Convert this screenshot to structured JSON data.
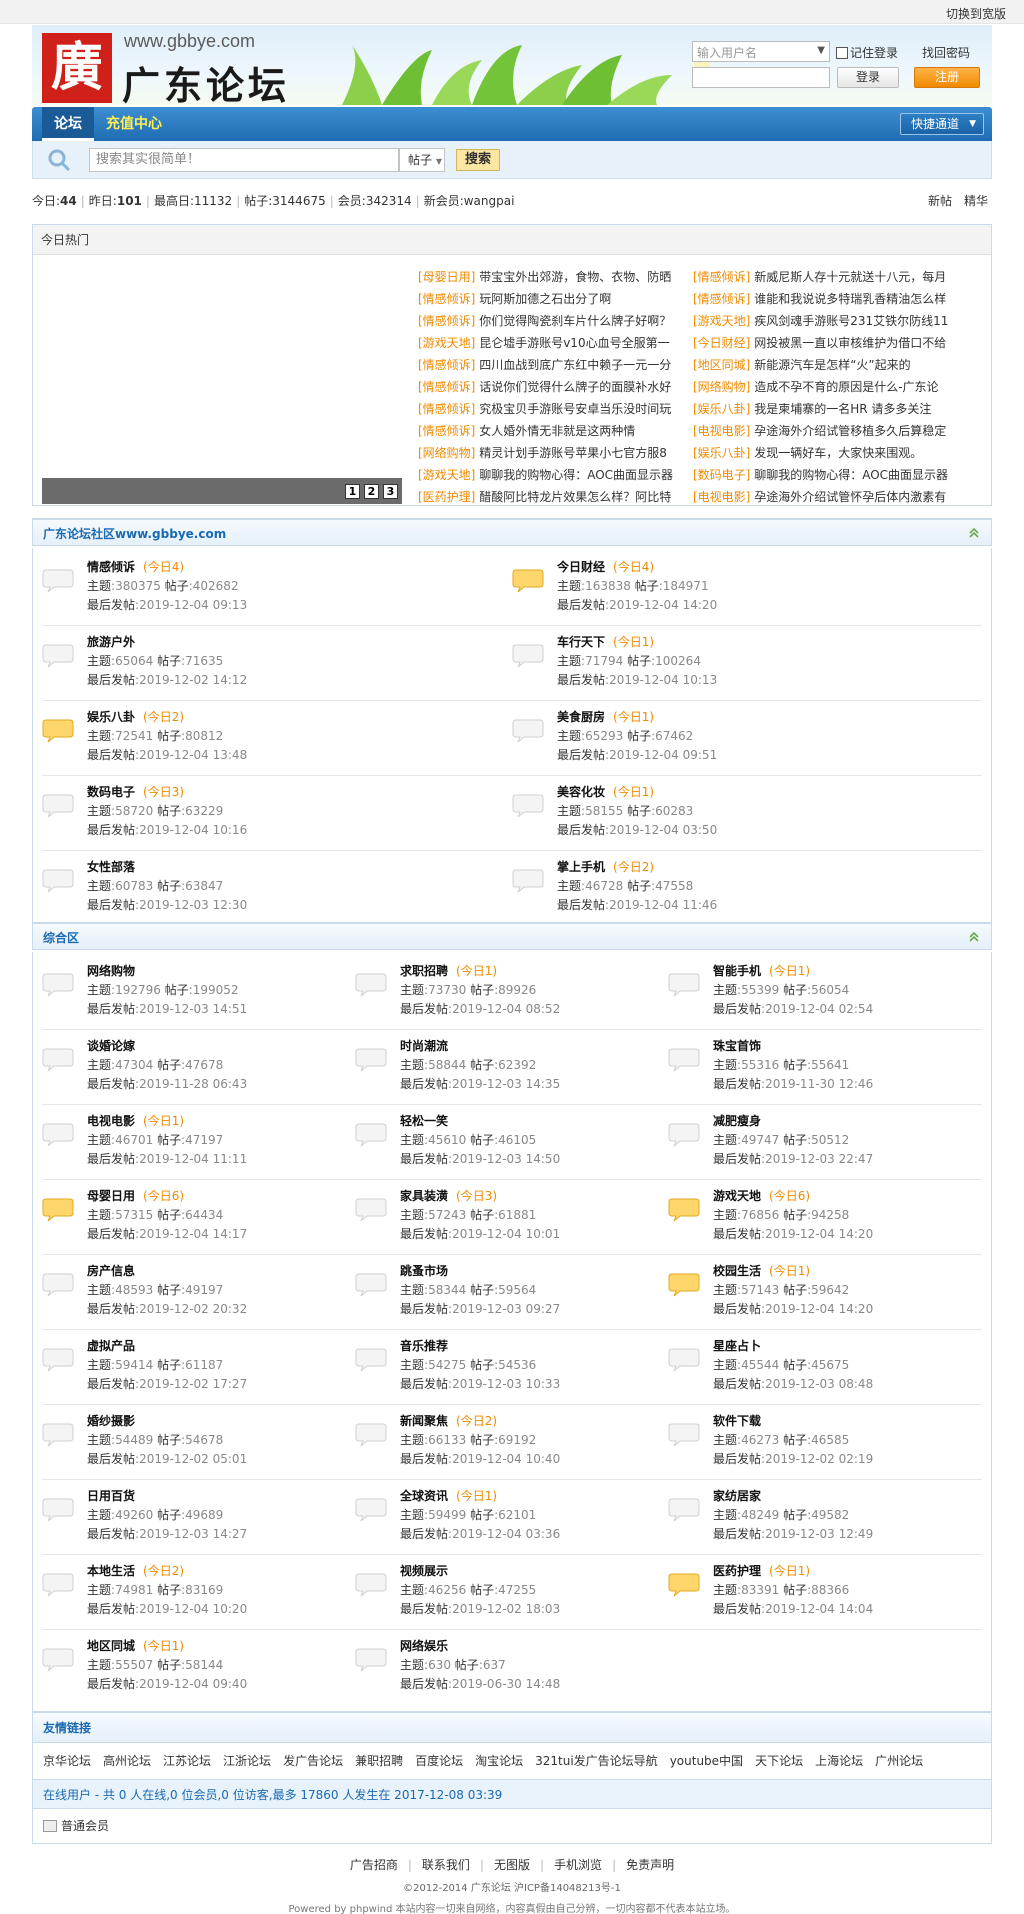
{
  "topbar": {
    "switch_label": "切换到宽版"
  },
  "header": {
    "logo_char": "廣",
    "logo_url": "www.gbbye.com",
    "logo_name": "广东论坛"
  },
  "login": {
    "username_placeholder": "输入用户名",
    "remember_label": "记住登录",
    "find_password": "找回密码",
    "login_button": "登录",
    "register_button": "注册"
  },
  "nav": {
    "tabs": [
      "论坛",
      "充值中心"
    ],
    "quick_label": "快捷通道"
  },
  "search": {
    "placeholder": "搜索其实很简单！",
    "type": "帖子",
    "button": "搜索"
  },
  "stats": {
    "today_label": "今日:",
    "today": "44",
    "yesterday_label": "昨日:",
    "yesterday": "101",
    "max_label": "最高日:",
    "max": "11132",
    "posts_label": "帖子:",
    "posts": "3144675",
    "members_label": "会员:",
    "members": "342314",
    "newmember_label": "新会员:",
    "newmember": "wangpai",
    "right": [
      "新帖",
      "精华"
    ]
  },
  "hot": {
    "title": "今日热门",
    "pages": [
      "1",
      "2",
      "3"
    ],
    "left": [
      {
        "cat": "[母婴日用]",
        "title": "带宝宝外出郊游，食物、衣物、防晒"
      },
      {
        "cat": "[情感倾诉]",
        "title": "玩阿斯加德之石出分了啊"
      },
      {
        "cat": "[情感倾诉]",
        "title": "你们觉得陶瓷刹车片什么牌子好啊？"
      },
      {
        "cat": "[游戏天地]",
        "title": "昆仑墟手游账号v10心血号全服第一"
      },
      {
        "cat": "[情感倾诉]",
        "title": "四川血战到底广东红中赖子一元一分"
      },
      {
        "cat": "[情感倾诉]",
        "title": "话说你们觉得什么牌子的面膜补水好"
      },
      {
        "cat": "[情感倾诉]",
        "title": "究极宝贝手游账号安卓当乐没时间玩"
      },
      {
        "cat": "[情感倾诉]",
        "title": "女人婚外情无非就是这两种情"
      },
      {
        "cat": "[网络购物]",
        "title": "精灵计划手游账号苹果小七官方服8"
      },
      {
        "cat": "[游戏天地]",
        "title": "聊聊我的购物心得：AOC曲面显示器"
      },
      {
        "cat": "[医药护理]",
        "title": "醋酸阿比特龙片效果怎么样？阿比特"
      }
    ],
    "right": [
      {
        "cat": "[情感倾诉]",
        "title": "新威尼斯人存十元就送十八元，每月"
      },
      {
        "cat": "[情感倾诉]",
        "title": "谁能和我说说多特瑞乳香精油怎么样"
      },
      {
        "cat": "[游戏天地]",
        "title": "疾风剑魂手游账号231艾铁尔防线11"
      },
      {
        "cat": "[今日财经]",
        "title": "网投被黑一直以审核维护为借口不给"
      },
      {
        "cat": "[地区同城]",
        "title": "新能源汽车是怎样“火”起来的"
      },
      {
        "cat": "[网络购物]",
        "title": "造成不孕不育的原因是什么-广东论"
      },
      {
        "cat": "[娱乐八卦]",
        "title": "我是柬埔寨的一名HR 请多多关注"
      },
      {
        "cat": "[电视电影]",
        "title": "孕途海外介绍试管移植多久后算稳定"
      },
      {
        "cat": "[娱乐八卦]",
        "title": "发现一辆好车，大家快来围观。"
      },
      {
        "cat": "[数码电子]",
        "title": "聊聊我的购物心得：AOC曲面显示器"
      },
      {
        "cat": "[电视电影]",
        "title": "孕途海外介绍试管怀孕后体内激素有"
      }
    ]
  },
  "section1": {
    "title": "广东论坛社区www.gbbye.com",
    "forums": [
      {
        "name": "情感倾诉",
        "today": "(今日4)",
        "topics": "380375",
        "posts": "402682",
        "last": "2019-12-04 09:13",
        "hot": false
      },
      {
        "name": "今日财经",
        "today": "(今日4)",
        "topics": "163838",
        "posts": "184971",
        "last": "2019-12-04 14:20",
        "hot": true
      },
      {
        "name": "旅游户外",
        "today": "",
        "topics": "65064",
        "posts": "71635",
        "last": "2019-12-02 14:12",
        "hot": false
      },
      {
        "name": "车行天下",
        "today": "(今日1)",
        "topics": "71794",
        "posts": "100264",
        "last": "2019-12-04 10:13",
        "hot": false
      },
      {
        "name": "娱乐八卦",
        "today": "(今日2)",
        "topics": "72541",
        "posts": "80812",
        "last": "2019-12-04 13:48",
        "hot": true
      },
      {
        "name": "美食厨房",
        "today": "(今日1)",
        "topics": "65293",
        "posts": "67462",
        "last": "2019-12-04 09:51",
        "hot": false
      },
      {
        "name": "数码电子",
        "today": "(今日3)",
        "topics": "58720",
        "posts": "63229",
        "last": "2019-12-04 10:16",
        "hot": false
      },
      {
        "name": "美容化妆",
        "today": "(今日1)",
        "topics": "58155",
        "posts": "60283",
        "last": "2019-12-04 03:50",
        "hot": false
      },
      {
        "name": "女性部落",
        "today": "",
        "topics": "60783",
        "posts": "63847",
        "last": "2019-12-03 12:30",
        "hot": false
      },
      {
        "name": "掌上手机",
        "today": "(今日2)",
        "topics": "46728",
        "posts": "47558",
        "last": "2019-12-04 11:46",
        "hot": false
      }
    ]
  },
  "section2": {
    "title": "综合区",
    "forums": [
      {
        "name": "网络购物",
        "today": "",
        "topics": "192796",
        "posts": "199052",
        "last": "2019-12-03 14:51",
        "hot": false
      },
      {
        "name": "求职招聘",
        "today": "(今日1)",
        "topics": "73730",
        "posts": "89926",
        "last": "2019-12-04 08:52",
        "hot": false
      },
      {
        "name": "智能手机",
        "today": "(今日1)",
        "topics": "55399",
        "posts": "56054",
        "last": "2019-12-04 02:54",
        "hot": false
      },
      {
        "name": "谈婚论嫁",
        "today": "",
        "topics": "47304",
        "posts": "47678",
        "last": "2019-11-28 06:43",
        "hot": false
      },
      {
        "name": "时尚潮流",
        "today": "",
        "topics": "58844",
        "posts": "62392",
        "last": "2019-12-03 14:35",
        "hot": false
      },
      {
        "name": "珠宝首饰",
        "today": "",
        "topics": "55316",
        "posts": "55641",
        "last": "2019-11-30 12:46",
        "hot": false
      },
      {
        "name": "电视电影",
        "today": "(今日1)",
        "topics": "46701",
        "posts": "47197",
        "last": "2019-12-04 11:11",
        "hot": false
      },
      {
        "name": "轻松一笑",
        "today": "",
        "topics": "45610",
        "posts": "46105",
        "last": "2019-12-03 14:50",
        "hot": false
      },
      {
        "name": "减肥瘦身",
        "today": "",
        "topics": "49747",
        "posts": "50512",
        "last": "2019-12-03 22:47",
        "hot": false
      },
      {
        "name": "母婴日用",
        "today": "(今日6)",
        "topics": "57315",
        "posts": "64434",
        "last": "2019-12-04 14:17",
        "hot": true
      },
      {
        "name": "家具装潢",
        "today": "(今日3)",
        "topics": "57243",
        "posts": "61881",
        "last": "2019-12-04 10:01",
        "hot": false
      },
      {
        "name": "游戏天地",
        "today": "(今日6)",
        "topics": "76856",
        "posts": "94258",
        "last": "2019-12-04 14:20",
        "hot": true
      },
      {
        "name": "房产信息",
        "today": "",
        "topics": "48593",
        "posts": "49197",
        "last": "2019-12-02 20:32",
        "hot": false
      },
      {
        "name": "跳蚤市场",
        "today": "",
        "topics": "58344",
        "posts": "59564",
        "last": "2019-12-03 09:27",
        "hot": false
      },
      {
        "name": "校园生活",
        "today": "(今日1)",
        "topics": "57143",
        "posts": "59642",
        "last": "2019-12-04 14:20",
        "hot": true
      },
      {
        "name": "虚拟产品",
        "today": "",
        "topics": "59414",
        "posts": "61187",
        "last": "2019-12-02 17:27",
        "hot": false
      },
      {
        "name": "音乐推荐",
        "today": "",
        "topics": "54275",
        "posts": "54536",
        "last": "2019-12-03 10:33",
        "hot": false
      },
      {
        "name": "星座占卜",
        "today": "",
        "topics": "45544",
        "posts": "45675",
        "last": "2019-12-03 08:48",
        "hot": false
      },
      {
        "name": "婚纱摄影",
        "today": "",
        "topics": "54489",
        "posts": "54678",
        "last": "2019-12-02 05:01",
        "hot": false
      },
      {
        "name": "新闻聚焦",
        "today": "(今日2)",
        "topics": "66133",
        "posts": "69192",
        "last": "2019-12-04 10:40",
        "hot": false
      },
      {
        "name": "软件下载",
        "today": "",
        "topics": "46273",
        "posts": "46585",
        "last": "2019-12-02 02:19",
        "hot": false
      },
      {
        "name": "日用百货",
        "today": "",
        "topics": "49260",
        "posts": "49689",
        "last": "2019-12-03 14:27",
        "hot": false
      },
      {
        "name": "全球资讯",
        "today": "(今日1)",
        "topics": "59499",
        "posts": "62101",
        "last": "2019-12-04 03:36",
        "hot": false
      },
      {
        "name": "家纺居家",
        "today": "",
        "topics": "48249",
        "posts": "49582",
        "last": "2019-12-03 12:49",
        "hot": false
      },
      {
        "name": "本地生活",
        "today": "(今日2)",
        "topics": "74981",
        "posts": "83169",
        "last": "2019-12-04 10:20",
        "hot": false
      },
      {
        "name": "视频展示",
        "today": "",
        "topics": "46256",
        "posts": "47255",
        "last": "2019-12-02 18:03",
        "hot": false
      },
      {
        "name": "医药护理",
        "today": "(今日1)",
        "topics": "83391",
        "posts": "88366",
        "last": "2019-12-04 14:04",
        "hot": true
      },
      {
        "name": "地区同城",
        "today": "(今日1)",
        "topics": "55507",
        "posts": "58144",
        "last": "2019-12-04 09:40",
        "hot": false
      },
      {
        "name": "网络娱乐",
        "today": "",
        "topics": "630",
        "posts": "637",
        "last": "2019-06-30 14:48",
        "hot": false
      }
    ]
  },
  "labels": {
    "topics": "主题",
    "posts": "帖子",
    "last": "最后发帖"
  },
  "friends": {
    "title": "友情链接",
    "links": [
      "京华论坛",
      "高州论坛",
      "江苏论坛",
      "江浙论坛",
      "发广告论坛",
      "兼职招聘",
      "百度论坛",
      "淘宝论坛",
      "321tui发广告论坛导航",
      "youtube中国",
      "天下论坛",
      "上海论坛",
      "广州论坛"
    ]
  },
  "online": {
    "text": "在线用户 - 共 0 人在线,0 位会员,0 位访客,最多 17860 人发生在 2017-12-08 03:39"
  },
  "member": {
    "label": "普通会员"
  },
  "footer": {
    "links": [
      "广告招商",
      "联系我们",
      "无图版",
      "手机浏览",
      "免责声明"
    ],
    "copyright": "©2012-2014 广东论坛 沪ICP备14048213号-1",
    "powered": "Powered by phpwind 本站内容一切来自网络，内容真假由自己分辨，一切内容都不代表本站立场。"
  },
  "colors": {
    "accent": "#1a6ab3",
    "orange": "#f08a00",
    "nav_blue": "#2574bd"
  }
}
